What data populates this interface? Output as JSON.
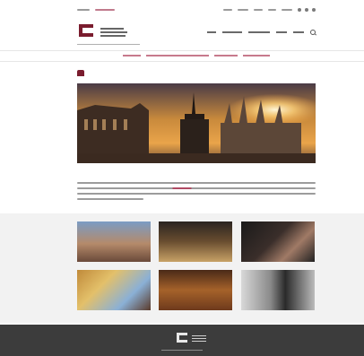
{
  "topbar": {
    "links": [],
    "social_icons": [
      "facebook-icon",
      "instagram-icon",
      "youtube-icon"
    ]
  },
  "header": {
    "logo_text": "",
    "tagline": "",
    "nav": []
  },
  "breadcrumb": {
    "items": []
  },
  "page": {
    "title": "",
    "intro_heading": "",
    "intro_text": ""
  },
  "tiles": [
    {
      "label": ""
    },
    {
      "label": ""
    },
    {
      "label": ""
    },
    {
      "label": ""
    },
    {
      "label": ""
    },
    {
      "label": ""
    }
  ],
  "footer": {
    "logo_text": "",
    "subtitle": ""
  },
  "colors": {
    "brand": "#7a1c2e",
    "footer": "#3c3c3c",
    "tile_band": "#f2f2f2"
  }
}
